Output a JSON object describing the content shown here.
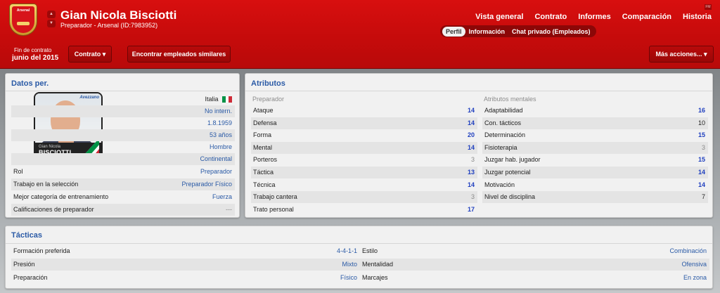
{
  "header": {
    "club_crest_text": "Arsenal",
    "name": "Gian Nicola Bisciotti",
    "subtitle": "Preparador - Arsenal (ID:7983952)",
    "corner_badge": "FM",
    "top_tabs": [
      "Vista general",
      "Contrato",
      "Informes",
      "Comparación",
      "Historia"
    ],
    "sub_tabs": [
      "Perfil",
      "Información",
      "Chat privado (Empleados)"
    ],
    "contract_label": "Fin de contrato",
    "contract_value": "junio del 2015",
    "contract_button": "Contrato ▾",
    "similar_button": "Encontrar empleados similares",
    "more_button": "Más acciones... ▾"
  },
  "personal": {
    "title": "Datos per.",
    "card": {
      "first_name": "Gian  Nicola",
      "last_name": "BISCIOTTI",
      "logo_text": "Avezzano"
    },
    "info": [
      "Italia",
      "No intern.",
      "1.8.1959",
      "53 años",
      "Hombre",
      "Continental"
    ],
    "nationality_colors": [
      "#009246",
      "#ffffff",
      "#ce2b37"
    ],
    "rows": [
      {
        "label": "Rol",
        "value": "Preparador"
      },
      {
        "label": "Trabajo en la selección",
        "value": "Preparador Físico"
      },
      {
        "label": "Mejor categoría de entrenamiento",
        "value": "Fuerza"
      },
      {
        "label": "Calificaciones de preparador",
        "value": "---"
      }
    ]
  },
  "attributes": {
    "title": "Atributos",
    "left_heading": "Preparador",
    "right_heading": "Atributos mentales",
    "left": [
      {
        "label": "Ataque",
        "value": "14"
      },
      {
        "label": "Defensa",
        "value": "14"
      },
      {
        "label": "Forma",
        "value": "20"
      },
      {
        "label": "Mental",
        "value": "14"
      },
      {
        "label": "Porteros",
        "value": "3"
      },
      {
        "label": "Táctica",
        "value": "13"
      },
      {
        "label": "Técnica",
        "value": "14"
      },
      {
        "label": "Trabajo cantera",
        "value": "3"
      },
      {
        "label": "Trato personal",
        "value": "17"
      }
    ],
    "right": [
      {
        "label": "Adaptabilidad",
        "value": "16"
      },
      {
        "label": "Con. tácticos",
        "value": "10"
      },
      {
        "label": "Determinación",
        "value": "15"
      },
      {
        "label": "Fisioterapia",
        "value": "3"
      },
      {
        "label": "Juzgar hab. jugador",
        "value": "15"
      },
      {
        "label": "Juzgar potencial",
        "value": "14"
      },
      {
        "label": "Motivación",
        "value": "14"
      },
      {
        "label": "Nivel de disciplina",
        "value": "7"
      }
    ]
  },
  "tactics": {
    "title": "Tácticas",
    "left": [
      {
        "label": "Formación preferida",
        "value": "4-4-1-1"
      },
      {
        "label": "Presión",
        "value": "Mixto"
      },
      {
        "label": "Preparación",
        "value": "Físico"
      }
    ],
    "right": [
      {
        "label": "Estilo",
        "value": "Combinación"
      },
      {
        "label": "Mentalidad",
        "value": "Ofensiva"
      },
      {
        "label": "Marcajes",
        "value": "En zona"
      }
    ]
  },
  "colors": {
    "header_red": "#c60b0b",
    "link_blue": "#2a5aa6",
    "value_blue": "#1f3fbf"
  }
}
